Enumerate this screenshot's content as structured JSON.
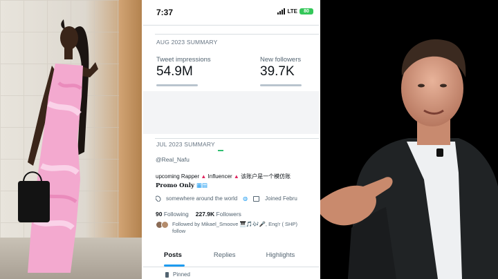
{
  "phone": {
    "status": {
      "time": "7:37",
      "network": "LTE",
      "battery": "80"
    },
    "aug_summary": {
      "title": "AUG 2023 SUMMARY",
      "impressions_label": "Tweet impressions",
      "impressions_value": "54.9M",
      "followers_label": "New followers",
      "followers_value": "39.7K"
    },
    "jul_summary": {
      "title": "JUL 2023 SUMMARY"
    },
    "profile": {
      "handle": "@Real_Nafu",
      "bio_line": "upcoming Rapper",
      "bio_influencer": "Influencer",
      "bio_chinese": "该账户是一个模仿账",
      "promo": "Promo Only",
      "location": "somewhere around the world",
      "joined": "Joined Febru",
      "following_count": "90",
      "following_label": "Following",
      "followers_count": "227.9K",
      "followers_label": "Followers",
      "followed_by": "Followed by Mikael_Smoove",
      "followed_by_rest": ", Eng'r ( SHP)",
      "followed_by_line2": "follow"
    },
    "tabs": {
      "posts": "Posts",
      "replies": "Replies",
      "highlights": "Highlights"
    },
    "pinned_label": "Pinned"
  },
  "colors": {
    "accent": "#1d9bf0",
    "battery": "#34c759",
    "warning": "#e0245e"
  }
}
